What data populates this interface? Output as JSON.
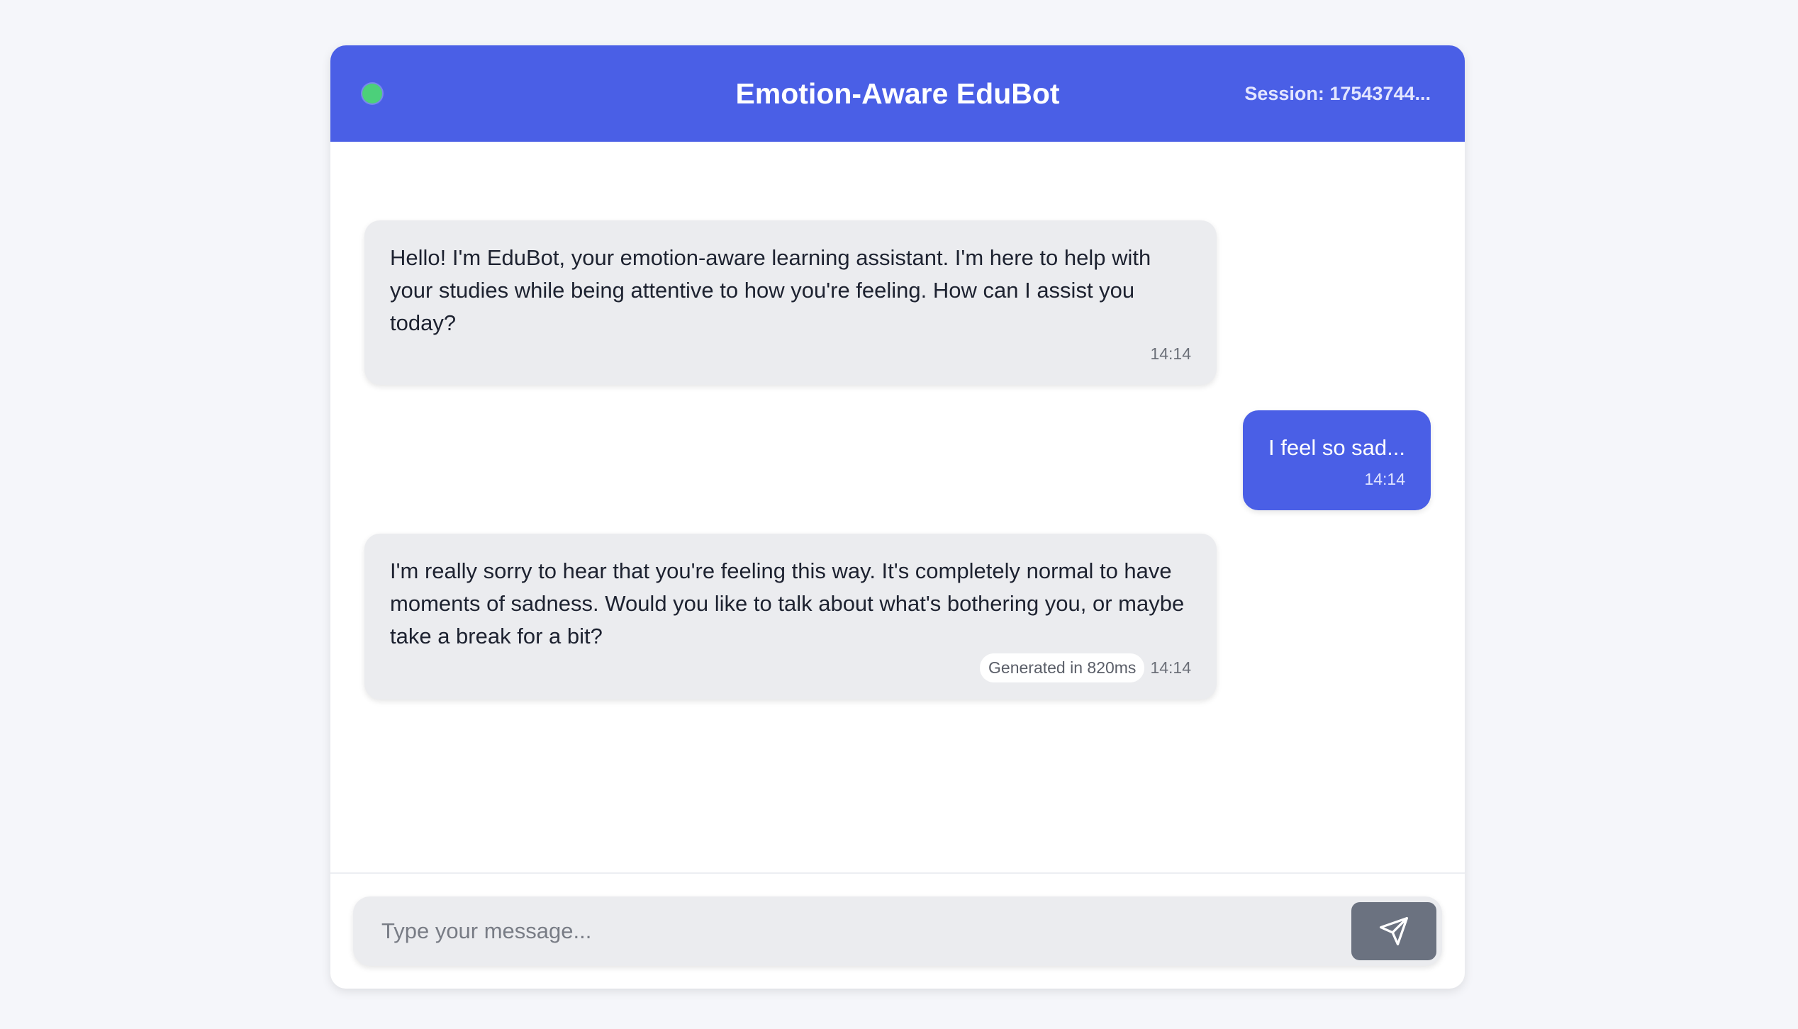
{
  "header": {
    "title": "Emotion-Aware EduBot",
    "session": "Session: 17543744...",
    "status_color": "#4cd07a"
  },
  "messages": [
    {
      "role": "bot",
      "text": "Hello! I'm EduBot, your emotion-aware learning assistant. I'm here to help with your studies while being attentive to how you're feeling. How can I assist you today?",
      "time": "14:14"
    },
    {
      "role": "user",
      "text": "I feel so sad...",
      "time": "14:14"
    },
    {
      "role": "bot",
      "text": "I'm really sorry to hear that you're feeling this way. It's completely normal to have moments of sadness. Would you like to talk about what's bothering you, or maybe take a break for a bit?",
      "time": "14:14",
      "generated": "Generated in 820ms"
    }
  ],
  "composer": {
    "placeholder": "Type your message...",
    "value": "",
    "send_icon": "send-icon"
  },
  "colors": {
    "accent": "#4a5fe6",
    "bot_bubble": "#ebecef",
    "send_button": "#6b7280",
    "background": "#f5f6fa"
  }
}
